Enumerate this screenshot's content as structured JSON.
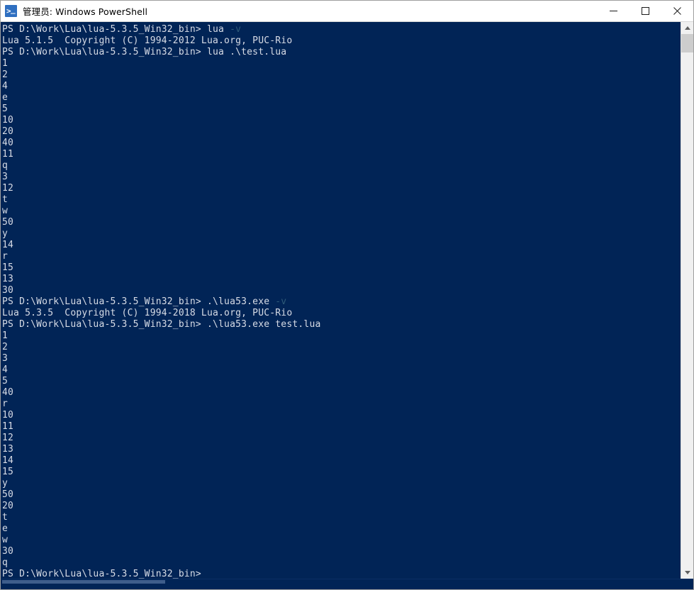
{
  "window": {
    "title": "管理员: Windows PowerShell",
    "icon": "powershell-icon",
    "bg_color": "#012456",
    "text_color": "#d8dce6",
    "dim_color": "#2e5a78",
    "titlebar_bg": "#ffffff",
    "controls": {
      "minimize": "minimize-button",
      "maximize": "maximize-button",
      "close": "close-button"
    }
  },
  "console": {
    "prompt": "PS D:\\Work\\Lua\\lua-5.3.5_Win32_bin>",
    "lines": [
      {
        "text": "PS D:\\Work\\Lua\\lua-5.3.5_Win32_bin> lua ",
        "suffix": "-v",
        "suffix_dim": true
      },
      {
        "text": "Lua 5.1.5  Copyright (C) 1994-2012 Lua.org, PUC-Rio"
      },
      {
        "text": "PS D:\\Work\\Lua\\lua-5.3.5_Win32_bin> lua .\\test.lua"
      },
      {
        "text": "1"
      },
      {
        "text": "2"
      },
      {
        "text": "4"
      },
      {
        "text": "e"
      },
      {
        "text": "5"
      },
      {
        "text": "10"
      },
      {
        "text": "20"
      },
      {
        "text": "40"
      },
      {
        "text": "11"
      },
      {
        "text": "q"
      },
      {
        "text": "3"
      },
      {
        "text": "12"
      },
      {
        "text": "t"
      },
      {
        "text": "w"
      },
      {
        "text": "50"
      },
      {
        "text": "y"
      },
      {
        "text": "14"
      },
      {
        "text": "r"
      },
      {
        "text": "15"
      },
      {
        "text": "13"
      },
      {
        "text": "30"
      },
      {
        "text": "PS D:\\Work\\Lua\\lua-5.3.5_Win32_bin> .\\lua53.exe ",
        "suffix": "-v",
        "suffix_dim": true
      },
      {
        "text": "Lua 5.3.5  Copyright (C) 1994-2018 Lua.org, PUC-Rio"
      },
      {
        "text": "PS D:\\Work\\Lua\\lua-5.3.5_Win32_bin> .\\lua53.exe test.lua"
      },
      {
        "text": "1"
      },
      {
        "text": "2"
      },
      {
        "text": "3"
      },
      {
        "text": "4"
      },
      {
        "text": "5"
      },
      {
        "text": "40"
      },
      {
        "text": "r"
      },
      {
        "text": "10"
      },
      {
        "text": "11"
      },
      {
        "text": "12"
      },
      {
        "text": "13"
      },
      {
        "text": "14"
      },
      {
        "text": "15"
      },
      {
        "text": "y"
      },
      {
        "text": "50"
      },
      {
        "text": "20"
      },
      {
        "text": "t"
      },
      {
        "text": "e"
      },
      {
        "text": "w"
      },
      {
        "text": "30"
      },
      {
        "text": "q"
      },
      {
        "text": "PS D:\\Work\\Lua\\lua-5.3.5_Win32_bin>"
      }
    ]
  },
  "scrollbars": {
    "vertical": {
      "up_icon": "chevron-up-icon",
      "down_icon": "chevron-down-icon"
    },
    "horizontal": {
      "present": true
    }
  }
}
